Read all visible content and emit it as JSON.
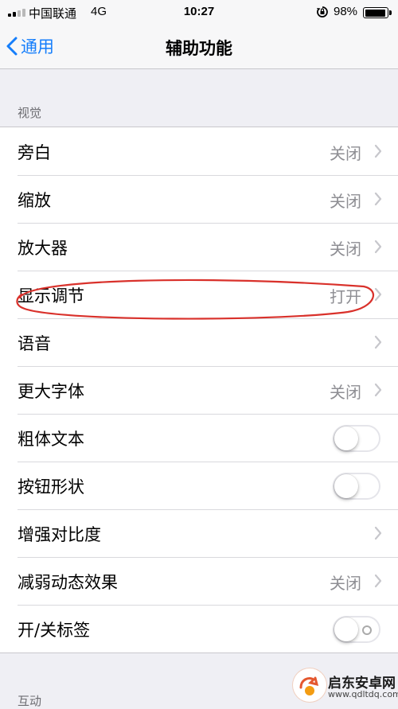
{
  "status_bar": {
    "carrier": "中国联通",
    "network": "4G",
    "time": "10:27",
    "battery_percent": "98%",
    "battery_level": 0.98,
    "signal_bars": 2
  },
  "nav": {
    "back_label": "通用",
    "title": "辅助功能"
  },
  "sections": {
    "vision_header": "视觉",
    "interaction_header": "互动"
  },
  "rows": [
    {
      "label": "旁白",
      "value": "关闭",
      "accessory": "chevron"
    },
    {
      "label": "缩放",
      "value": "关闭",
      "accessory": "chevron"
    },
    {
      "label": "放大器",
      "value": "关闭",
      "accessory": "chevron"
    },
    {
      "label": "显示调节",
      "value": "打开",
      "accessory": "chevron"
    },
    {
      "label": "语音",
      "value": "",
      "accessory": "chevron"
    },
    {
      "label": "更大字体",
      "value": "关闭",
      "accessory": "chevron"
    },
    {
      "label": "粗体文本",
      "value": "",
      "accessory": "toggle",
      "toggle_on": false
    },
    {
      "label": "按钮形状",
      "value": "",
      "accessory": "toggle",
      "toggle_on": false
    },
    {
      "label": "增强对比度",
      "value": "",
      "accessory": "chevron"
    },
    {
      "label": "减弱动态效果",
      "value": "关闭",
      "accessory": "chevron"
    },
    {
      "label": "开/关标签",
      "value": "",
      "accessory": "toggle",
      "toggle_on": false
    }
  ],
  "annotation": {
    "highlighted_row": "显示调节",
    "color": "#d9312b"
  },
  "watermark": {
    "title": "启东安卓网",
    "url": "www.qdltdq.com"
  },
  "colors": {
    "accent": "#157efb",
    "background": "#efeff4",
    "secondary_text": "#8e8e93"
  }
}
